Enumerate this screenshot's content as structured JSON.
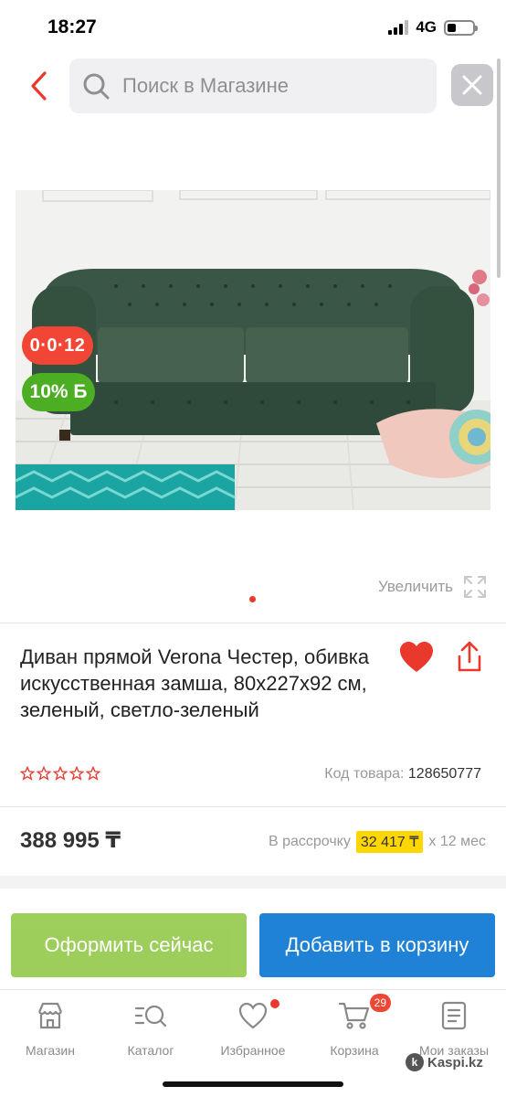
{
  "status_bar": {
    "time": "18:27",
    "network": "4G"
  },
  "search": {
    "placeholder": "Поиск в Магазине"
  },
  "product": {
    "badge_installment": "0·0·12",
    "badge_bonus": "10%",
    "badge_bonus_symbol": "Б",
    "zoom_label": "Увеличить",
    "title": "Диван прямой Verona Честер, обивка искусственная замша, 80x227x92 см, зеленый, светло-зеленый",
    "sku_label": "Код товара:",
    "sku_value": "128650777",
    "price": "388 995 ₸",
    "installment_prefix": "В рассрочку",
    "installment_amount": "32 417 ₸",
    "installment_suffix": "x 12 мес",
    "rating_stars": 0
  },
  "actions": {
    "buy_now": "Оформить сейчас",
    "add_to_cart": "Добавить в корзину"
  },
  "tabbar": {
    "items": [
      {
        "label": "Магазин",
        "icon": "store-icon"
      },
      {
        "label": "Каталог",
        "icon": "catalog-search-icon"
      },
      {
        "label": "Избранное",
        "icon": "heart-outline-icon"
      },
      {
        "label": "Корзина",
        "icon": "cart-icon"
      },
      {
        "label": "Мои заказы",
        "icon": "orders-icon"
      }
    ],
    "cart_count": "29"
  },
  "watermark": "Kaspi.kz",
  "colors": {
    "accent_red": "#f14635",
    "green": "#8dc63f",
    "blue": "#1f82d6",
    "highlight": "#ffd600"
  }
}
